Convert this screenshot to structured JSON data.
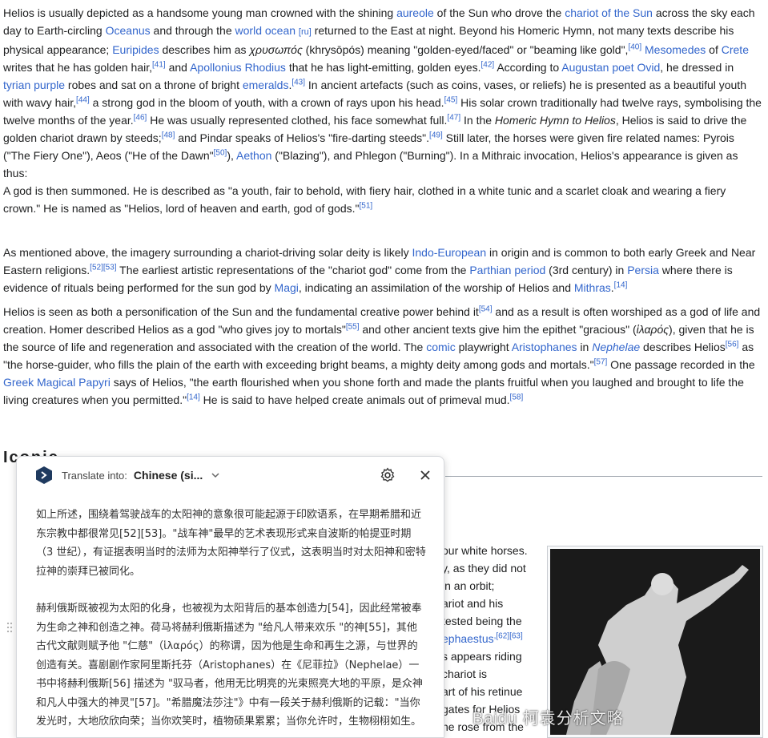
{
  "article": {
    "para1": {
      "t1": "Helios is usually depicted as a handsome young man crowned with the shining ",
      "l_aureole": "aureole",
      "t2": " of the Sun who drove the ",
      "l_chariot": "chariot of the Sun",
      "t3": " across the sky each day to Earth-circling ",
      "l_oceanus": "Oceanus",
      "t4": " and through the ",
      "l_world_ocean": "world ocean",
      "l_ru": "[ru]",
      "t5": " returned to the East at night. Beyond his Homeric Hymn, not many texts describe his physical appearance; ",
      "l_euripides": "Euripides",
      "t6": " describes him as ",
      "greek1": "χρυσωπός",
      "t7": " (khrysōpós) meaning \"golden-eyed/faced\" or \"beaming like gold\",",
      "r40": "[40]",
      "t8": " ",
      "l_mesomedes": "Mesomedes",
      "t9": " of ",
      "l_crete": "Crete",
      "t10": " writes that he has golden hair,",
      "r41": "[41]",
      "t11": " and ",
      "l_apollonius": "Apollonius Rhodius",
      "t12": " that he has light-emitting, golden eyes.",
      "r42": "[42]",
      "t13": " According to ",
      "l_augustan": "Augustan poet",
      "t14": " ",
      "l_ovid": "Ovid",
      "t15": ", he dressed in ",
      "l_tyrian": "tyrian purple",
      "t16": " robes and sat on a throne of bright ",
      "l_emeralds": "emeralds",
      "t17": ".",
      "r43": "[43]",
      "t18": " In ancient artefacts (such as coins, vases, or reliefs) he is presented as a beautiful youth with wavy hair,",
      "r44": "[44]",
      "t19": " a strong god in the bloom of youth, with a crown of rays upon his head.",
      "r45": "[45]",
      "t20": " His solar crown traditionally had twelve rays, symbolising the twelve months of the year.",
      "r46": "[46]",
      "t21": " He was usually represented clothed, his face somewhat full.",
      "r47": "[47]",
      "t22": " In the ",
      "i_hymn": "Homeric Hymn to Helios",
      "t23": ", Helios is said to drive the golden chariot drawn by steeds;",
      "r48": "[48]",
      "t24": " and Pindar speaks of Helios's \"fire-darting steeds\".",
      "r49": "[49]",
      "t25": " Still later, the horses were given fire related names: Pyrois (\"The Fiery One\"), Aeos (\"He of the Dawn\"",
      "r50": "[50]",
      "t26": "), ",
      "l_aethon": "Aethon",
      "t27": " (\"Blazing\"), and Phlegon (\"Burning\"). In a Mithraic invocation, Helios's appearance is given as thus:"
    },
    "quote": {
      "t1": "A god is then summoned. He is described as \"a youth, fair to behold, with fiery hair, clothed in a white tunic and a scarlet cloak and wearing a fiery crown.\" He is named as \"Helios, lord of heaven and earth, god of gods.\"",
      "r51": "[51]"
    },
    "para2": {
      "t1": "As mentioned above, the imagery surrounding a chariot-driving solar deity is likely ",
      "l_indo": "Indo-European",
      "t2": " in origin and is common to both early Greek and Near Eastern religions.",
      "r52": "[52]",
      "r53": "[53]",
      "t3": " The earliest artistic representations of the \"chariot god\" come from the ",
      "l_parthian": "Parthian period",
      "t4": " (3rd century) in ",
      "l_persia": "Persia",
      "t5": " where there is evidence of rituals being performed for the sun god by ",
      "l_magi": "Magi",
      "t6": ", indicating an assimilation of the worship of Helios and ",
      "l_mithras": "Mithras",
      "t7": ".",
      "r14": "[14]"
    },
    "para3": {
      "t1": "Helios is seen as both a personification of the Sun and the fundamental creative power behind it",
      "r54": "[54]",
      "t2": " and as a result is often worshiped as a god of life and creation. Homer described Helios as a god \"who gives joy to mortals\"",
      "r55": "[55]",
      "t3": " and other ancient texts give him the epithet \"gracious\" (",
      "greek2": "ἱλαρός",
      "t4": "), given that he is the source of life and regeneration and associated with the creation of the world. The ",
      "l_comic": "comic",
      "t5": " playwright ",
      "l_aristophanes": "Aristophanes",
      "t6": " in ",
      "l_nephelae": "Nephelae",
      "t7": " describes Helios",
      "r56": "[56]",
      "t8": " as \"the horse-guider, who fills the plain of the earth with exceeding bright beams, a mighty deity among gods and mortals.\"",
      "r57": "[57]",
      "t9": " One passage recorded in the ",
      "l_papyri": "Greek Magical Papyri",
      "t10": " says of Helios, \"the earth flourished when you shone forth and made the plants fruitful when you laughed and brought to life the living creatures when you permitted.\"",
      "r14": "[14]",
      "t11": " He is said to have helped create animals out of primeval mud.",
      "r58": "[58]"
    },
    "heading_fragment": "Iconic",
    "right_col": {
      "line1": "our white horses.",
      "line2": "y, as they did not",
      "line3": "in an orbit;",
      "line4": "ariot and his",
      "line5": "tested being the",
      "line6_link": "ephaestus",
      "line6_refs": ",[62][63]",
      "line7": "s appears riding",
      "line8": "chariot is",
      "line9": "art of his retinue",
      "line10": "gates for Helios",
      "line11": "he rose from the"
    },
    "watermark": "Baidu 柯袁分析文略"
  },
  "translate_panel": {
    "label": "Translate into:",
    "language": "Chinese (si...",
    "para1": "如上所述，围绕着驾驶战车的太阳神的意象很可能起源于印欧语系，在早期希腊和近东宗教中都很常见[52][53]。\"战车神\"最早的艺术表现形式来自波斯的帕提亚时期（3 世纪），有证据表明当时的法师为太阳神举行了仪式，这表明当时对太阳神和密特拉神的崇拜已被同化。",
    "para2": "赫利俄斯既被视为太阳的化身，也被视为太阳背后的基本创造力[54]，因此经常被奉为生命之神和创造之神。荷马将赫利俄斯描述为 \"给凡人带来欢乐 \"的神[55]，其他古代文献则赋予他 \"仁慈\"（ἱλαρός）的称谓，因为他是生命和再生之源，与世界的创造有关。喜剧剧作家阿里斯托芬（Aristophanes）在《尼菲拉》（Nephelae）一书中将赫利俄斯[56] 描述为 \"驭马者，他用无比明亮的光束照亮大地的平原，是众神和凡人中强大的神灵\"[57]。\"希腊魔法莎注\"》中有一段关于赫利俄斯的记载：\"当你发光时，大地欣欣向荣；当你欢笑时，植物硕果累累；当你允许时，生物栩栩如生。"
  },
  "colors": {
    "link": "#3366cc",
    "text": "#202122",
    "panel_border": "#d6d8dc"
  }
}
